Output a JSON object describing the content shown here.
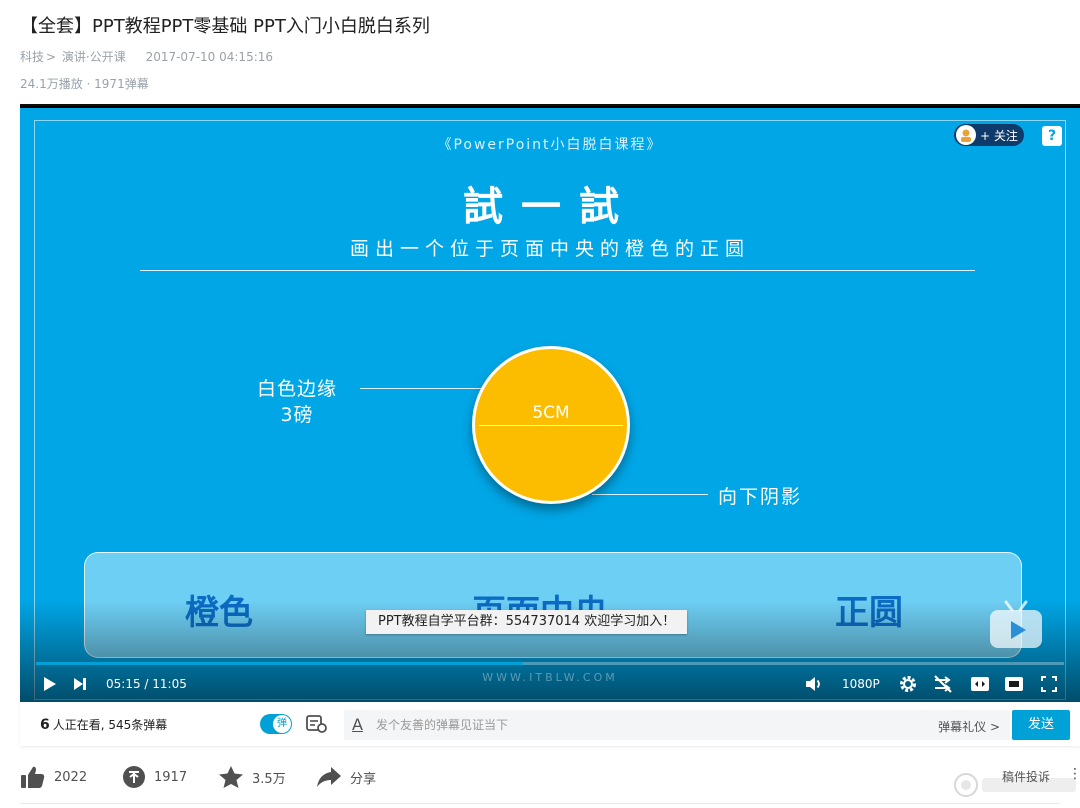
{
  "video": {
    "title": "【全套】PPT教程PPT零基础 PPT入门小白脱白系列",
    "category": "科技",
    "subcategory": "演讲·公开课",
    "date": "2017-07-10 04:15:16",
    "stats": "24.1万播放 · 1971弹幕"
  },
  "slide": {
    "course": "《PowerPoint小白脱白课程》",
    "title": "試一試",
    "subtitle": "画出一个位于页面中央的橙色的正圆",
    "circle_label": "5CM",
    "annotation_left_line1": "白色边缘",
    "annotation_left_line2": "3磅",
    "annotation_right": "向下阴影",
    "req1": "橙色",
    "req2": "页面中央",
    "req3": "正圆",
    "watermark": "WWW.ITBLW.COM",
    "colors": {
      "background": "#00a6e6",
      "circle": "#fcbd00",
      "req_text": "#0b6cc4"
    }
  },
  "player": {
    "danmaku_text": "PPT教程自学平台群：554737014 欢迎学习加入！",
    "time": "05:15 / 11:05",
    "progress": 0.474,
    "quality": "1080P",
    "follow_label": "+ 关注",
    "help_label": "?",
    "accent_color": "#00a1d6"
  },
  "danmaku_bar": {
    "viewer_count": "6",
    "viewer_text": "人正在看, 545条弹幕",
    "toggle_label": "弹",
    "input_placeholder": "发个友善的弹幕见证当下",
    "gift_label": "弹幕礼仪 >",
    "send_label": "发送"
  },
  "actions": {
    "like": "2022",
    "coin": "1917",
    "favorite": "3.5万",
    "share": "分享",
    "report": "稿件投诉"
  }
}
